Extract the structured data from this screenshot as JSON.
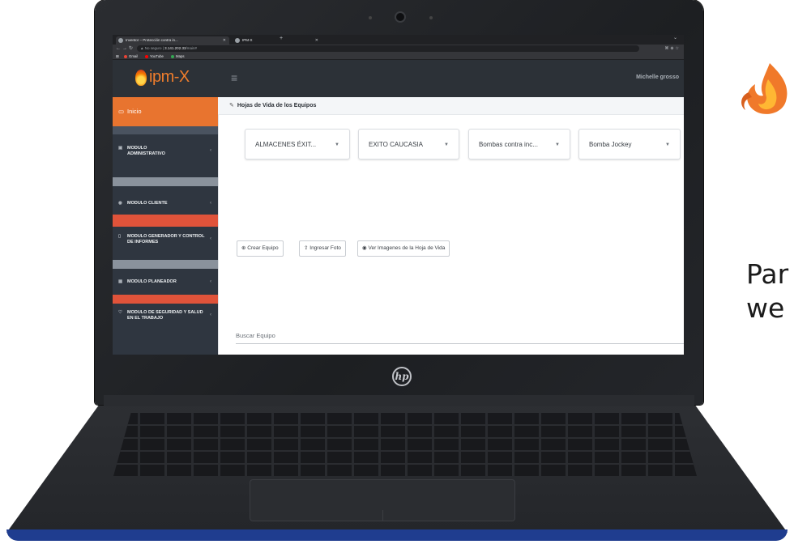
{
  "browser": {
    "tabs": [
      {
        "label": "Inventor – Protección contra in...",
        "active": true
      },
      {
        "label": "IPM-X",
        "active": false
      }
    ],
    "new_tab_label": "+",
    "address": {
      "security_label": "No seguro",
      "host": "3.141.202.33",
      "path": "/main#"
    },
    "bookmarks": [
      {
        "label": "Gmail",
        "color": "#ea4335"
      },
      {
        "label": "YouTube",
        "color": "#ff0000"
      },
      {
        "label": "Maps",
        "color": "#34a853"
      }
    ]
  },
  "app": {
    "brand_text": "ipm-X",
    "user_name": "Michelle grosso",
    "accent_color": "#e8742f"
  },
  "sidebar": {
    "items": [
      {
        "icon": "monitor-icon",
        "label": "Inicio",
        "active": true
      },
      {
        "icon": "briefcase-icon",
        "label": "MODULO ADMINISTRATIVO"
      },
      {
        "icon": "user-circle-icon",
        "label": "MODULO CLIENTE"
      },
      {
        "icon": "document-icon",
        "label": "MODULO GENERADOR Y CONTROL DE INFORMES"
      },
      {
        "icon": "calendar-icon",
        "label": "MODULO PLANEADOR"
      },
      {
        "icon": "shield-icon",
        "label": "MODULO DE SEGURIDAD Y SALUD EN EL TRABAJO"
      }
    ]
  },
  "main": {
    "title": "Hojas de Vida de los Equipos",
    "filters": [
      {
        "value": "ALMACENES ÉXIT..."
      },
      {
        "value": "EXITO CAUCASIA"
      },
      {
        "value": "Bombas contra inc..."
      },
      {
        "value": "Bomba Jockey"
      }
    ],
    "buttons": {
      "create": "Crear Equipo",
      "upload_photo": "Ingresar Foto",
      "view_images": "Ver Imagenes de la Hoja de Vida"
    },
    "search_placeholder": "Buscar Equipo"
  },
  "promo": {
    "text_line1": "Par",
    "text_line2": "we"
  }
}
